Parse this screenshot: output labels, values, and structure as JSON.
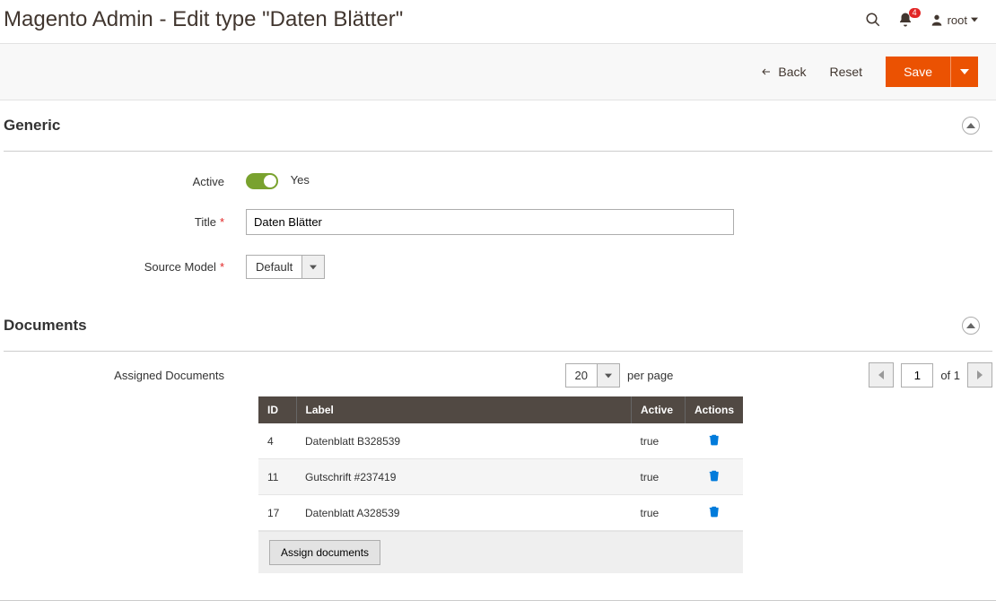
{
  "header": {
    "title": "Magento Admin - Edit type \"Daten Blätter\"",
    "notification_count": "4",
    "user_name": "root"
  },
  "actions": {
    "back": "Back",
    "reset": "Reset",
    "save": "Save"
  },
  "sections": {
    "generic": {
      "title": "Generic"
    },
    "documents": {
      "title": "Documents"
    }
  },
  "form": {
    "active_label": "Active",
    "active_value": "Yes",
    "title_label": "Title",
    "title_value": "Daten Blätter",
    "source_model_label": "Source Model",
    "source_model_value": "Default"
  },
  "documents": {
    "assigned_label": "Assigned Documents",
    "per_page_value": "20",
    "per_page_label": "per page",
    "page_current": "1",
    "page_total_label": "of 1",
    "columns": {
      "id": "ID",
      "label": "Label",
      "active": "Active",
      "actions": "Actions"
    },
    "rows": [
      {
        "id": "4",
        "label": "Datenblatt B328539",
        "active": "true"
      },
      {
        "id": "11",
        "label": "Gutschrift #237419",
        "active": "true"
      },
      {
        "id": "17",
        "label": "Datenblatt A328539",
        "active": "true"
      }
    ],
    "assign_btn": "Assign documents"
  }
}
